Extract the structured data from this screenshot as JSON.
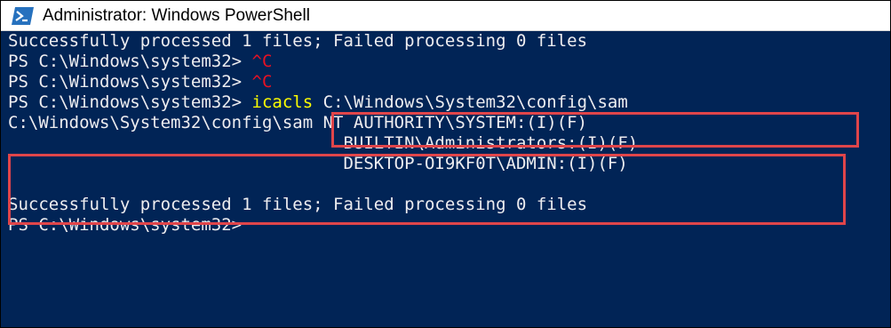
{
  "window": {
    "title": "Administrator: Windows PowerShell",
    "icon": "powershell-icon"
  },
  "console": {
    "lines": [
      {
        "text": "Successfully processed 1 files; Failed processing 0 files"
      },
      {
        "prompt": "PS C:\\Windows\\system32> ",
        "input": "^C"
      },
      {
        "prompt": "PS C:\\Windows\\system32> ",
        "input": "^C"
      },
      {
        "prompt": "PS C:\\Windows\\system32> ",
        "command": "icacls",
        "args": " C:\\Windows\\System32\\config\\sam"
      },
      {
        "text": "C:\\Windows\\System32\\config\\sam NT AUTHORITY\\SYSTEM:(I)(F)"
      },
      {
        "text": "                                 BUILTIN\\Administrators:(I)(F)"
      },
      {
        "text": "                                 DESKTOP-OI9KF0T\\ADMIN:(I)(F)"
      },
      {
        "text": ""
      },
      {
        "text": "Successfully processed 1 files; Failed processing 0 files"
      },
      {
        "prompt": "PS C:\\Windows\\system32>"
      }
    ]
  },
  "colors": {
    "background": "#012456",
    "foreground": "#eeedf0",
    "cancel": "#e81123",
    "command": "#ffff00",
    "highlight": "#e0454a"
  }
}
